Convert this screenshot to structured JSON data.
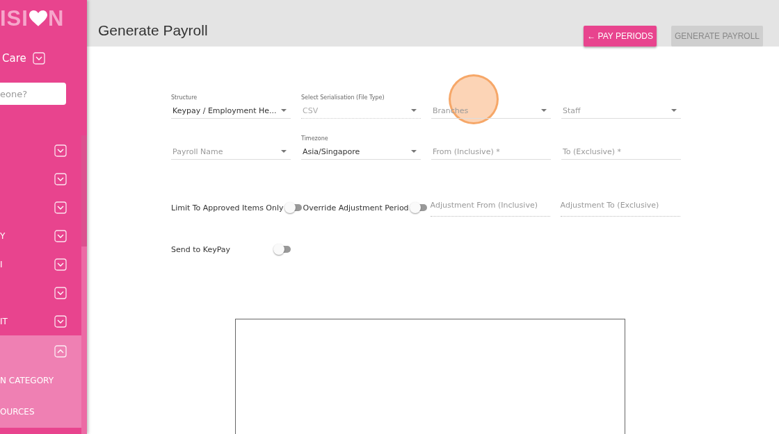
{
  "sidebar": {
    "logo": [
      "ISI",
      "N"
    ],
    "org": "Care",
    "search": {
      "placeholder": "eone?"
    },
    "items": [
      {
        "expanded": false
      },
      {
        "expanded": false
      },
      {
        "expanded": false
      },
      {
        "label": "Y",
        "expanded": false
      },
      {
        "label": "I",
        "expanded": false
      },
      {
        "expanded": false
      },
      {
        "label": "IT",
        "expanded": false
      },
      {
        "expanded": true,
        "children": [
          {
            "label": "N CATEGORY"
          },
          {
            "label": "OURCES"
          }
        ]
      }
    ]
  },
  "header": {
    "title": "Generate Payroll",
    "buttons": [
      {
        "label": "← PAY PERIODS",
        "disabled": false
      },
      {
        "label": "GENERATE PAYROLL",
        "disabled": true
      }
    ]
  },
  "fields": [
    {
      "kind": "select",
      "label": "Structure",
      "value": "Keypay / Employment He...",
      "disabled": false
    },
    {
      "kind": "select",
      "label": "Select Serialisation (File Type)",
      "value": "CSV",
      "disabled": true
    },
    {
      "kind": "select",
      "placeholder": "Branches",
      "disabled": false
    },
    {
      "kind": "select",
      "placeholder": "Staff",
      "disabled": false
    },
    {
      "kind": "select",
      "placeholder": "Payroll Name",
      "disabled": false
    },
    {
      "kind": "select",
      "label": "Timezone",
      "value": "Asia/Singapore",
      "disabled": false
    },
    {
      "kind": "date",
      "placeholder": "From (Inclusive) *",
      "disabled": false
    },
    {
      "kind": "date",
      "placeholder": "To (Exclusive) *",
      "disabled": false
    }
  ],
  "toggles": [
    {
      "label": "Limit To Approved Items Only",
      "on": false
    },
    {
      "label": "Override Adjustment Period",
      "on": false
    }
  ],
  "adjustment_fields": [
    {
      "placeholder": "Adjustment From (Inclusive)",
      "disabled": true
    },
    {
      "placeholder": "Adjustment To (Exclusive)",
      "disabled": true
    }
  ],
  "send_toggle": {
    "label": "Send to KeyPay",
    "on": false
  },
  "click_marker": true
}
